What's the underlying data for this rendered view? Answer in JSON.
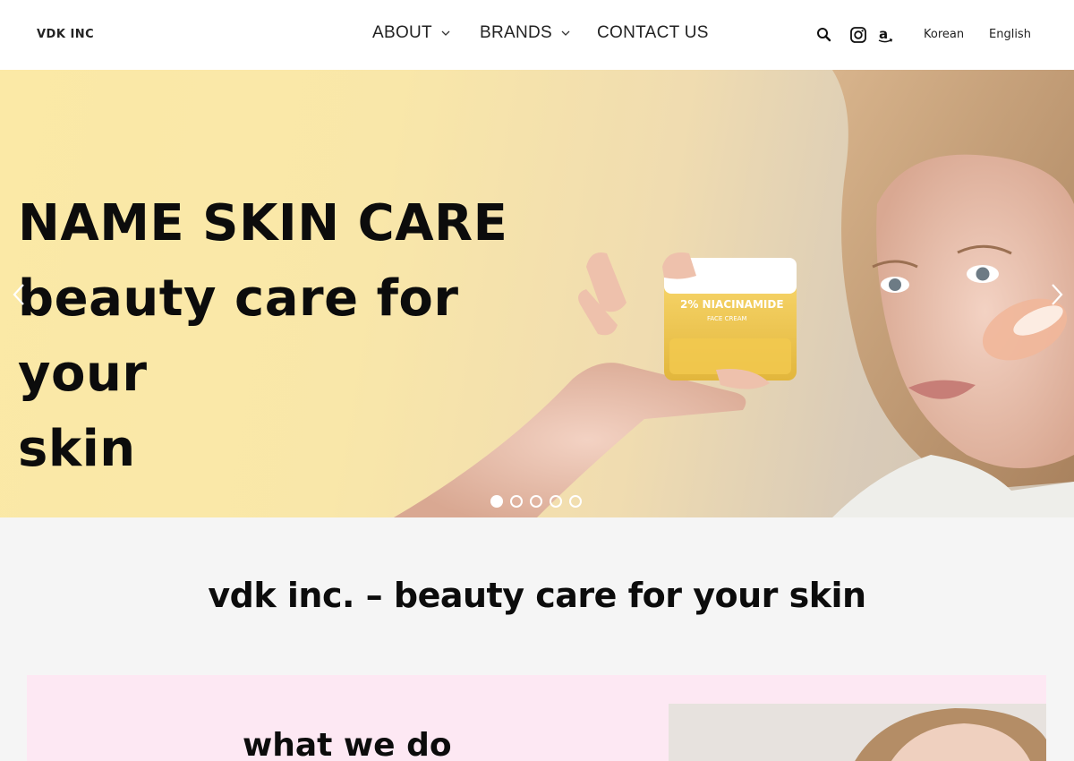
{
  "header": {
    "logo": "VDK INC",
    "nav": [
      {
        "label": "ABOUT",
        "has_dropdown": true
      },
      {
        "label": "BRANDS",
        "has_dropdown": true
      },
      {
        "label": "CONTACT US",
        "has_dropdown": false
      }
    ],
    "icons": [
      "search-icon",
      "instagram-icon",
      "amazon-icon"
    ],
    "languages": [
      "Korean",
      "English"
    ]
  },
  "hero": {
    "title_line1": "NAME SKIN CARE",
    "title_line2": "beauty care for your",
    "title_line3": "skin",
    "product_label": "2% NIACINAMIDE",
    "product_sub": "FACE CREAM",
    "slides_total": 5,
    "active_slide": 1,
    "background_color": "#fbe9a6"
  },
  "main": {
    "tagline": "vdk inc. – beauty care for your skin",
    "section_title": "what we do",
    "card_color": "#fde8f3"
  }
}
